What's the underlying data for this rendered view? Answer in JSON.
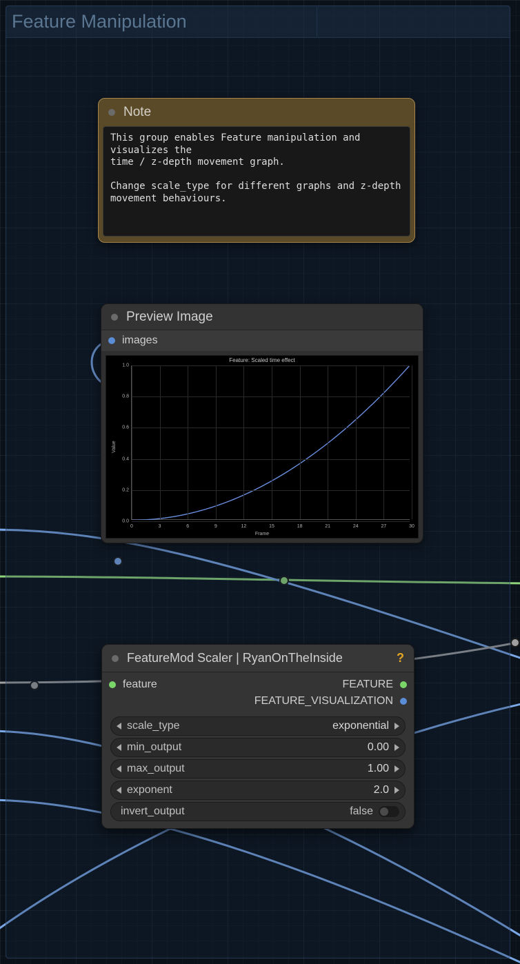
{
  "group": {
    "title": "Feature Manipulation"
  },
  "note": {
    "title": "Note",
    "body": "This group enables Feature manipulation and visualizes the\ntime / z-depth movement graph.\n\nChange scale_type for different graphs and z-depth\nmovement behaviours."
  },
  "preview": {
    "title": "Preview Image",
    "input_port": "images"
  },
  "fmod": {
    "title": "FeatureMod Scaler | RyanOnTheInside",
    "help": "?",
    "input_port": "feature",
    "output1": "FEATURE",
    "output2": "FEATURE_VISUALIZATION",
    "widgets": {
      "scale_type": {
        "label": "scale_type",
        "value": "exponential"
      },
      "min_output": {
        "label": "min_output",
        "value": "0.00"
      },
      "max_output": {
        "label": "max_output",
        "value": "1.00"
      },
      "exponent": {
        "label": "exponent",
        "value": "2.0"
      },
      "invert_output": {
        "label": "invert_output",
        "value": "false"
      }
    }
  },
  "chart_data": {
    "type": "line",
    "title": "Feature: Scaled time effect",
    "xlabel": "Frame",
    "ylabel": "Value",
    "xlim": [
      0,
      30
    ],
    "ylim": [
      0,
      1.0
    ],
    "x": [
      0,
      3,
      6,
      9,
      12,
      15,
      18,
      21,
      24,
      27,
      30
    ],
    "values": [
      0.0,
      0.01,
      0.04,
      0.09,
      0.16,
      0.25,
      0.36,
      0.49,
      0.64,
      0.81,
      1.0
    ],
    "yticks": [
      0.0,
      0.2,
      0.4,
      0.6,
      0.8,
      1.0
    ],
    "xticks": [
      0,
      3,
      6,
      9,
      12,
      15,
      18,
      21,
      24,
      27,
      30
    ]
  }
}
